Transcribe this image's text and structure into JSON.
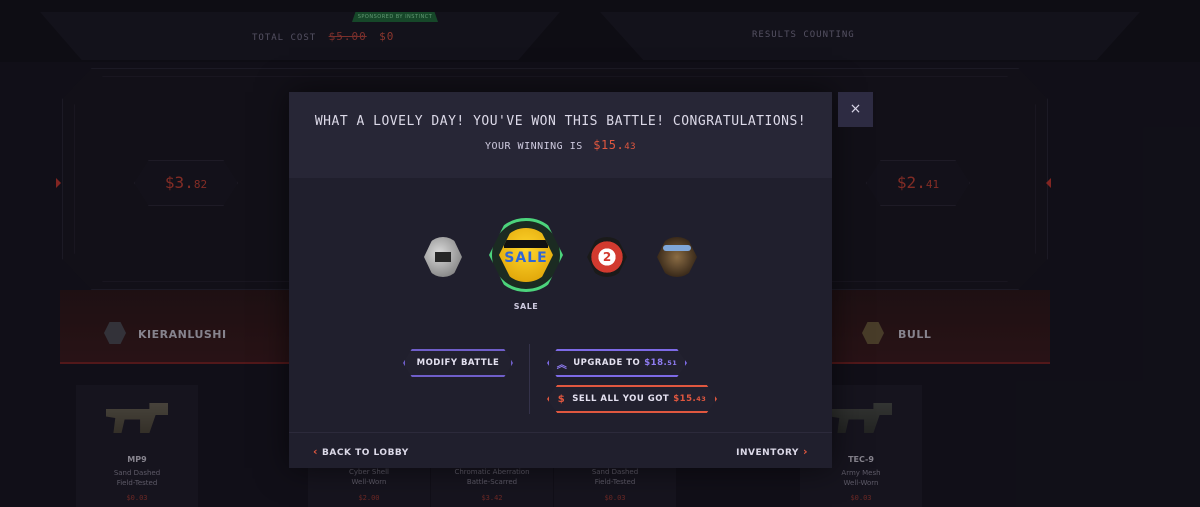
{
  "header": {
    "total_cost_label": "TOTAL COST",
    "total_cost_old": "$5.00",
    "total_cost_new": "$0",
    "sponsored_label": "SPONSORED BY INSTINCT",
    "results_label": "RESULTS COUNTING"
  },
  "arena": {
    "left_price_main": "$3.",
    "left_price_cents": "82",
    "right_price_main": "$2.",
    "right_price_cents": "41"
  },
  "players": [
    {
      "name": "KIERANLUSHI"
    },
    {
      "name": "BULL"
    }
  ],
  "items": [
    {
      "name": "MP9",
      "skin": "Sand Dashed",
      "wear": "Field-Tested",
      "price": "$0.03"
    },
    {
      "name": "",
      "skin": "Cyber Shell",
      "wear": "Well-Worn",
      "price": "$2.00"
    },
    {
      "name": "",
      "skin": "Chromatic Aberration",
      "wear": "Battle-Scarred",
      "price": "$3.42"
    },
    {
      "name": "",
      "skin": "Sand Dashed",
      "wear": "Field-Tested",
      "price": "$0.03"
    },
    {
      "name": "TEC-9",
      "skin": "Army Mesh",
      "wear": "Well-Worn",
      "price": "$0.03"
    }
  ],
  "modal": {
    "title": "WHAT A LOVELY DAY! YOU'VE WON THIS BATTLE! CONGRATULATIONS!",
    "winning_label": "YOUR WINNING IS",
    "winning_main": "$15.",
    "winning_cents": "43",
    "close_icon": "×",
    "featured_prize_label": "SALE",
    "featured_prize_text": "SALE",
    "gauge_text": "2",
    "accent_green": "#4cd47c",
    "accent_orange": "#e0573f",
    "accent_purple": "#7d6ae6",
    "buttons": {
      "modify": "MODIFY BATTLE",
      "upgrade_label": "UPGRADE TO",
      "upgrade_main": "$18.",
      "upgrade_cents": "51",
      "sell_label": "SELL ALL YOU GOT",
      "sell_main": "$15.",
      "sell_cents": "43"
    },
    "footer": {
      "back_label": "BACK TO LOBBY",
      "inventory_label": "INVENTORY"
    }
  }
}
